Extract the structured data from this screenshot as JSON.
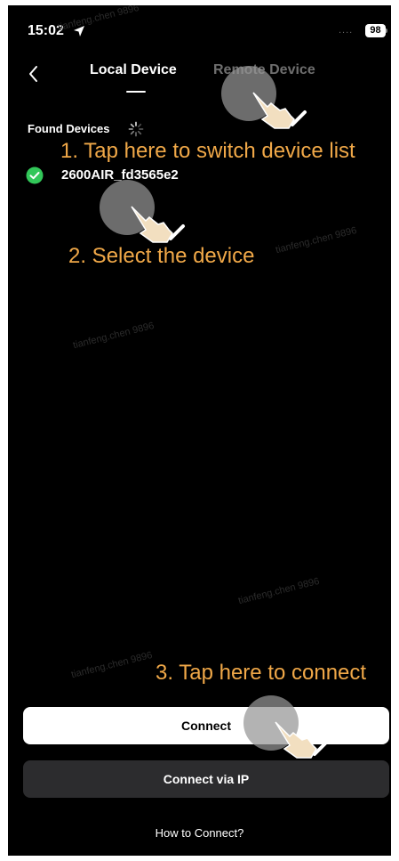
{
  "status_bar": {
    "time": "15:02",
    "signal": "....",
    "battery": "98"
  },
  "nav": {
    "back_label": "‹",
    "tabs": [
      {
        "label": "Local Device",
        "active": true
      },
      {
        "label": "Remote Device",
        "active": false
      }
    ]
  },
  "devices": {
    "section_label": "Found Devices",
    "items": [
      {
        "name": "2600AIR_fd3565e2",
        "selected": true
      }
    ]
  },
  "annotations": [
    "1. Tap here to switch device list",
    "2. Select the device",
    "3. Tap here to connect"
  ],
  "watermark": "tianfeng.chen 9896",
  "buttons": {
    "connect": "Connect",
    "connect_ip": "Connect via IP"
  },
  "footer": {
    "how_to_connect": "How to Connect?"
  },
  "colors": {
    "background": "#000000",
    "accent_annotation": "#f0a848",
    "check_green": "#32c759",
    "secondary_button": "#2c2c2e"
  },
  "icons": {
    "location": "location-arrow-icon",
    "spinner": "loading-spinner-icon",
    "check": "check-circle-icon",
    "back": "chevron-left-icon",
    "tap": "hand-tap-icon"
  }
}
